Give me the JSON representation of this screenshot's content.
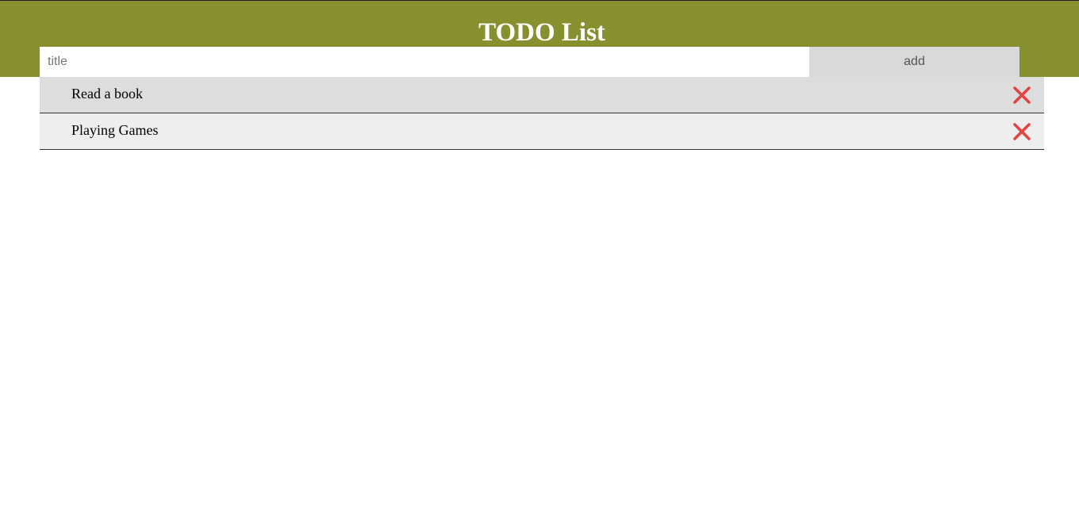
{
  "header": {
    "title": "TODO List",
    "background_color": "#878f2e"
  },
  "form": {
    "input_placeholder": "title",
    "input_value": "",
    "add_label": "add"
  },
  "todos": [
    {
      "text": "Read a book",
      "delete_icon": "close-icon"
    },
    {
      "text": "Playing Games",
      "delete_icon": "close-icon"
    }
  ],
  "colors": {
    "delete_icon": "#e04444",
    "row_odd": "#dddddd",
    "row_even": "#eeeeee"
  }
}
